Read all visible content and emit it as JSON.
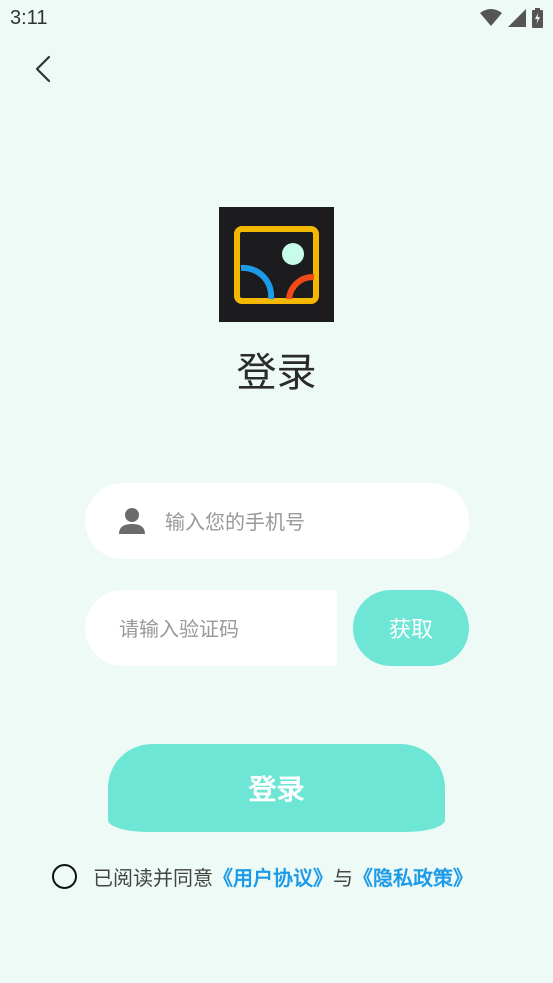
{
  "status_bar": {
    "time": "3:11",
    "icons": [
      "wifi-icon",
      "signal-icon",
      "battery-charging-icon"
    ]
  },
  "nav": {
    "back_icon": "chevron-left-icon"
  },
  "logo": {
    "icon": "app-logo-icon",
    "colors": {
      "frame": "#f5b800",
      "arc_left": "#1e9be8",
      "arc_right": "#f04a1a",
      "dot": "#c7fbea",
      "bg": "#1c1c1e"
    }
  },
  "page": {
    "title": "登录"
  },
  "phone": {
    "icon": "user-icon",
    "placeholder": "输入您的手机号",
    "value": ""
  },
  "code": {
    "placeholder": "请输入验证码",
    "value": "",
    "button_label": "获取"
  },
  "login": {
    "button_label": "登录"
  },
  "agreement": {
    "checked": false,
    "prefix": "已阅读并同意",
    "user_agreement": "《用户协议》",
    "conjunction": "与",
    "privacy_policy": "《隐私政策》"
  },
  "colors": {
    "accent": "#6ee6d6",
    "link": "#1e9be8",
    "background": "#eefaf5"
  }
}
